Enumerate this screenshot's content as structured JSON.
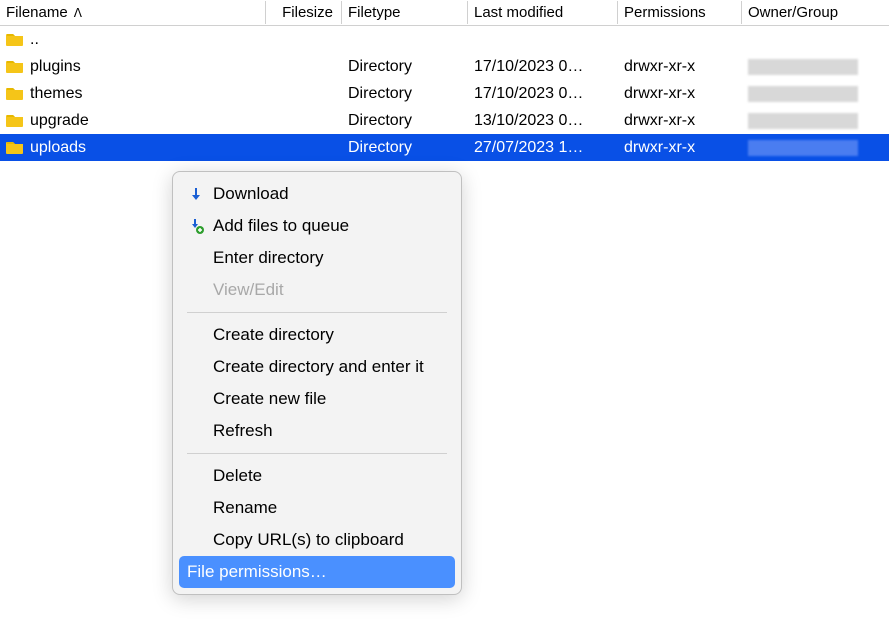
{
  "columns": {
    "filename": "Filename",
    "filesize": "Filesize",
    "filetype": "Filetype",
    "lastmod": "Last modified",
    "permissions": "Permissions",
    "owner": "Owner/Group"
  },
  "sort_indicator": "ᐱ",
  "rows": [
    {
      "name": "..",
      "filetype": "",
      "lastmod": "",
      "perms": "",
      "selected": false,
      "parent": true
    },
    {
      "name": "plugins",
      "filetype": "Directory",
      "lastmod": "17/10/2023 0…",
      "perms": "drwxr-xr-x",
      "selected": false
    },
    {
      "name": "themes",
      "filetype": "Directory",
      "lastmod": "17/10/2023 0…",
      "perms": "drwxr-xr-x",
      "selected": false
    },
    {
      "name": "upgrade",
      "filetype": "Directory",
      "lastmod": "13/10/2023 0…",
      "perms": "drwxr-xr-x",
      "selected": false
    },
    {
      "name": "uploads",
      "filetype": "Directory",
      "lastmod": "27/07/2023 1…",
      "perms": "drwxr-xr-x",
      "selected": true
    }
  ],
  "context_menu": {
    "download": "Download",
    "add_queue": "Add files to queue",
    "enter_dir": "Enter directory",
    "view_edit": "View/Edit",
    "create_dir": "Create directory",
    "create_dir_enter": "Create directory and enter it",
    "create_file": "Create new file",
    "refresh": "Refresh",
    "delete": "Delete",
    "rename": "Rename",
    "copy_urls": "Copy URL(s) to clipboard",
    "file_perms": "File permissions…"
  }
}
